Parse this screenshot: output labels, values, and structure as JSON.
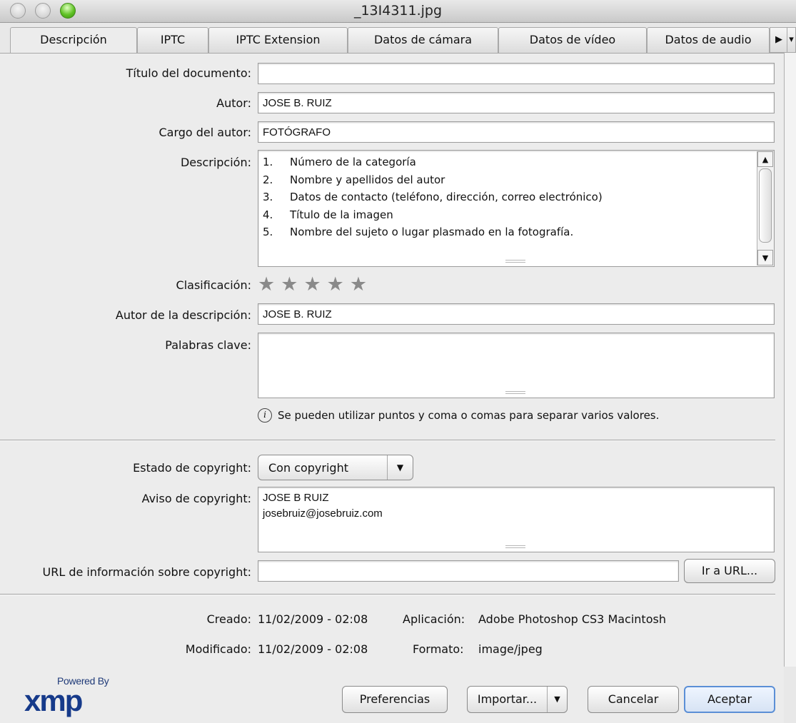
{
  "window": {
    "title": "_13I4311.jpg"
  },
  "tabs": [
    {
      "label": "Descripción",
      "active": true
    },
    {
      "label": "IPTC"
    },
    {
      "label": "IPTC Extension"
    },
    {
      "label": "Datos de cámara"
    },
    {
      "label": "Datos de vídeo"
    },
    {
      "label": "Datos de audio"
    }
  ],
  "form": {
    "titulo": {
      "label": "Título del documento:",
      "value": ""
    },
    "autor": {
      "label": "Autor:",
      "value": "JOSE B. RUIZ"
    },
    "cargo": {
      "label": "Cargo del autor:",
      "value": "FOTÓGRAFO"
    },
    "descripcion": {
      "label": "Descripción:",
      "items": [
        {
          "num": "1.",
          "text": "Número de la categoría"
        },
        {
          "num": "2.",
          "text": "Nombre y apellidos del autor"
        },
        {
          "num": "3.",
          "text": "Datos de contacto (teléfono, dirección, correo electrónico)"
        },
        {
          "num": "4.",
          "text": "Título de la imagen"
        },
        {
          "num": "5.",
          "text": "Nombre del sujeto o lugar plasmado en la fotografía."
        }
      ]
    },
    "clasificacion": {
      "label": "Clasificación:",
      "stars": 0,
      "max": 5
    },
    "autor_descripcion": {
      "label": "Autor de la descripción:",
      "value": "JOSE B. RUIZ"
    },
    "palabras_clave": {
      "label": "Palabras clave:",
      "value": ""
    },
    "hint": "Se pueden utilizar puntos y coma o comas para separar varios valores.",
    "estado_copyright": {
      "label": "Estado de copyright:",
      "value": "Con copyright"
    },
    "aviso_copyright": {
      "label": "Aviso de copyright:",
      "line1": "JOSE B RUIZ",
      "line2": "josebruiz@josebruiz.com"
    },
    "url_copyright": {
      "label": "URL de información sobre copyright:",
      "value": "",
      "button": "Ir a URL..."
    }
  },
  "info": {
    "creado_label": "Creado:",
    "creado_value": "11/02/2009 - 02:08",
    "aplicacion_label": "Aplicación:",
    "aplicacion_value": "Adobe Photoshop CS3 Macintosh",
    "modificado_label": "Modificado:",
    "modificado_value": "11/02/2009 - 02:08",
    "formato_label": "Formato:",
    "formato_value": "image/jpeg"
  },
  "footer": {
    "powered_by": "Powered By",
    "xmp": "xmp",
    "preferencias": "Preferencias",
    "importar": "Importar...",
    "cancelar": "Cancelar",
    "aceptar": "Aceptar"
  },
  "colors": {
    "accent": "#5b8fd6",
    "xmp_blue": "#163a8a"
  }
}
